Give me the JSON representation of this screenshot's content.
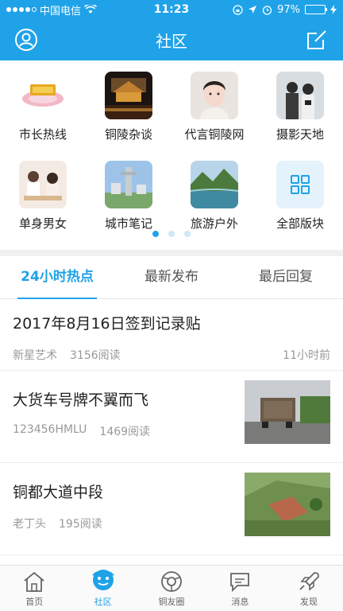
{
  "status": {
    "carrier": "中国电信",
    "time": "11:23",
    "battery": "97%",
    "battery_level": 0.97
  },
  "header": {
    "title": "社区",
    "profile_icon": "person-circle-icon",
    "compose_icon": "edit-icon"
  },
  "categories": [
    {
      "label": "市长热线"
    },
    {
      "label": "铜陵杂谈"
    },
    {
      "label": "代言铜陵网"
    },
    {
      "label": "摄影天地"
    },
    {
      "label": "单身男女"
    },
    {
      "label": "城市笔记"
    },
    {
      "label": "旅游户外"
    },
    {
      "label": "全部版块"
    }
  ],
  "pager": {
    "count": 3,
    "active": 0
  },
  "tabs": [
    {
      "label": "24小时热点"
    },
    {
      "label": "最新发布"
    },
    {
      "label": "最后回复"
    }
  ],
  "posts": [
    {
      "title": "2017年8月16日签到记录贴",
      "author": "新星艺术",
      "reads": "3156阅读",
      "time": "11小时前"
    },
    {
      "title": "大货车号牌不翼而飞",
      "author": "123456HMLU",
      "reads": "1469阅读"
    },
    {
      "title": "铜都大道中段",
      "author": "老丁头",
      "reads": "195阅读"
    }
  ],
  "bottom_nav": [
    {
      "label": "首页",
      "icon": "home-icon"
    },
    {
      "label": "社区",
      "icon": "community-icon"
    },
    {
      "label": "铜友圈",
      "icon": "friends-circle-icon"
    },
    {
      "label": "消息",
      "icon": "message-icon"
    },
    {
      "label": "发现",
      "icon": "rocket-icon"
    }
  ],
  "colors": {
    "accent": "#1fa2e8"
  }
}
